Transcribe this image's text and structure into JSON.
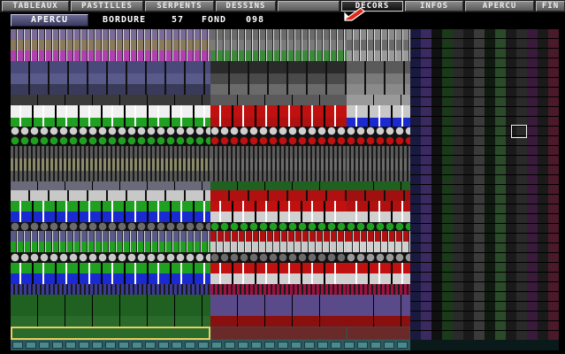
{
  "tabs": [
    {
      "label": "TABLEAUX",
      "active": false
    },
    {
      "label": "PASTILLES",
      "active": false
    },
    {
      "label": "SERPENTS",
      "active": false
    },
    {
      "label": "DESSINS",
      "active": false
    },
    {
      "label": "DECORS",
      "active": true
    },
    {
      "label": "INFOS",
      "active": false
    },
    {
      "label": "APERCU",
      "active": false
    },
    {
      "label": "FIN",
      "active": false
    }
  ],
  "header": {
    "apercu_button_label": "APERCU",
    "bordure_label": "BORDURE",
    "bordure_value": "57",
    "fond_label": "FOND",
    "fond_value": "098"
  },
  "colors": {
    "tab_face": "#707070",
    "button_face": "#50507a",
    "pointer_red": "#e02818",
    "cursor": "#f2f2f2"
  },
  "icons": {
    "pointer": "arrow-pointer-icon"
  }
}
